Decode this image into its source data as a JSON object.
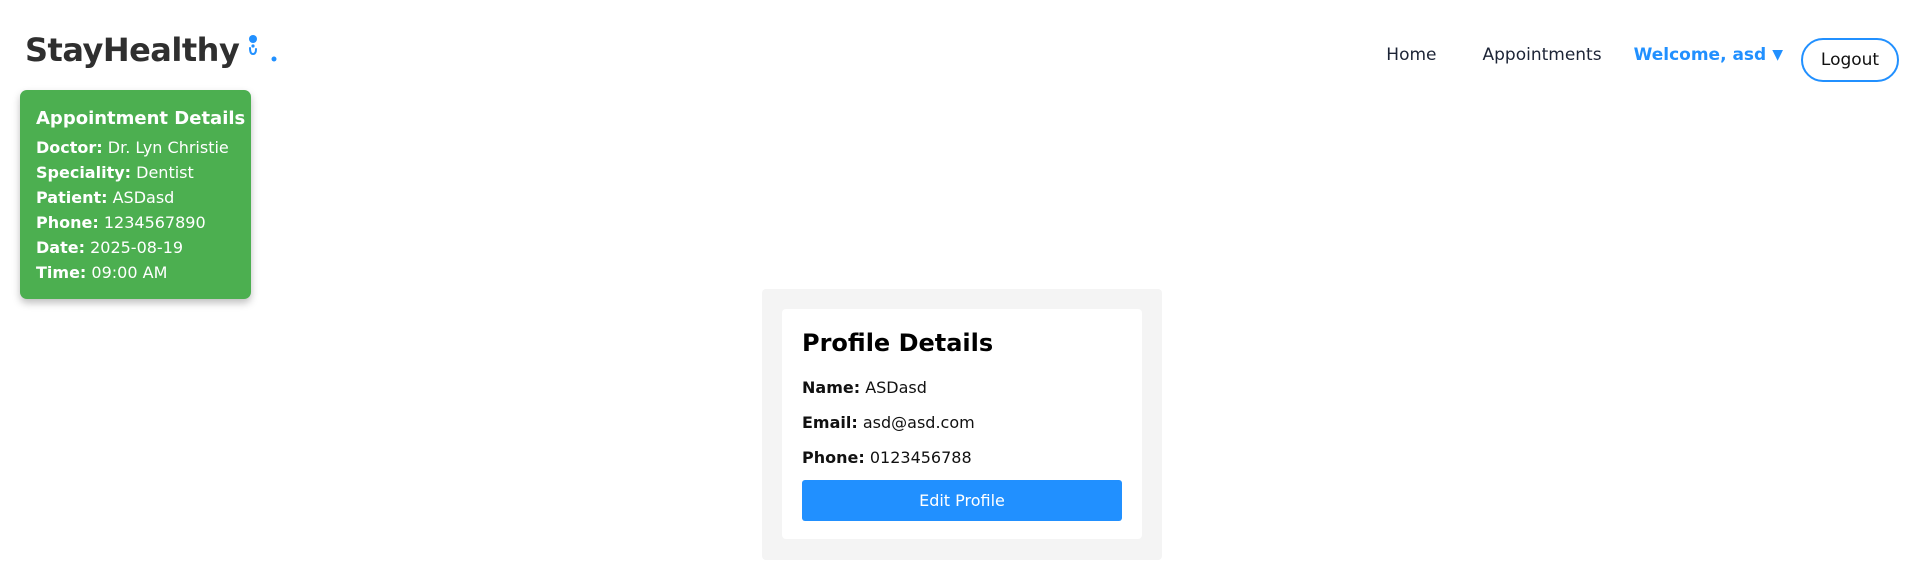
{
  "header": {
    "logo_text": "StayHealthy",
    "logo_icon": "person-dot-icon",
    "nav": {
      "home": "Home",
      "appointments": "Appointments",
      "welcome": "Welcome, asd",
      "welcome_caret": "▼",
      "logout": "Logout"
    }
  },
  "appointment": {
    "title": "Appointment Details",
    "doctor_label": "Doctor:",
    "doctor": "Dr. Lyn Christie",
    "speciality_label": "Speciality:",
    "speciality": "Dentist",
    "patient_label": "Patient:",
    "patient": "ASDasd",
    "phone_label": "Phone:",
    "phone": "1234567890",
    "date_label": "Date:",
    "date": "2025-08-19",
    "time_label": "Time:",
    "time": "09:00 AM"
  },
  "profile": {
    "title": "Profile Details",
    "name_label": "Name:",
    "name": "ASDasd",
    "email_label": "Email:",
    "email": "asd@asd.com",
    "phone_label": "Phone:",
    "phone": "0123456788",
    "edit_button": "Edit Profile"
  },
  "colors": {
    "accent": "#2190ff",
    "appointment_card": "#4caf50",
    "profile_outer": "#f4f4f4"
  }
}
